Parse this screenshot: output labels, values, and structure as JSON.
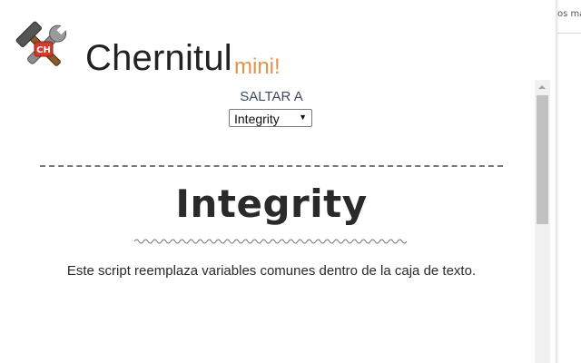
{
  "background_window": {
    "cut_text": "os ma"
  },
  "header": {
    "logo_initials": "CH",
    "brand_name": "Chernitul",
    "brand_suffix": "mini!"
  },
  "jump_to": {
    "label": "SALTAR A",
    "selected": "Integrity",
    "arrow_icon": "dropdown-arrow-icon"
  },
  "section": {
    "title": "Integrity",
    "description": "Este script reemplaza variables comunes dentro de la caja de texto."
  },
  "colors": {
    "brand_suffix": "#e0944a",
    "label": "#3d4a5c",
    "title": "#2a2a2a"
  }
}
